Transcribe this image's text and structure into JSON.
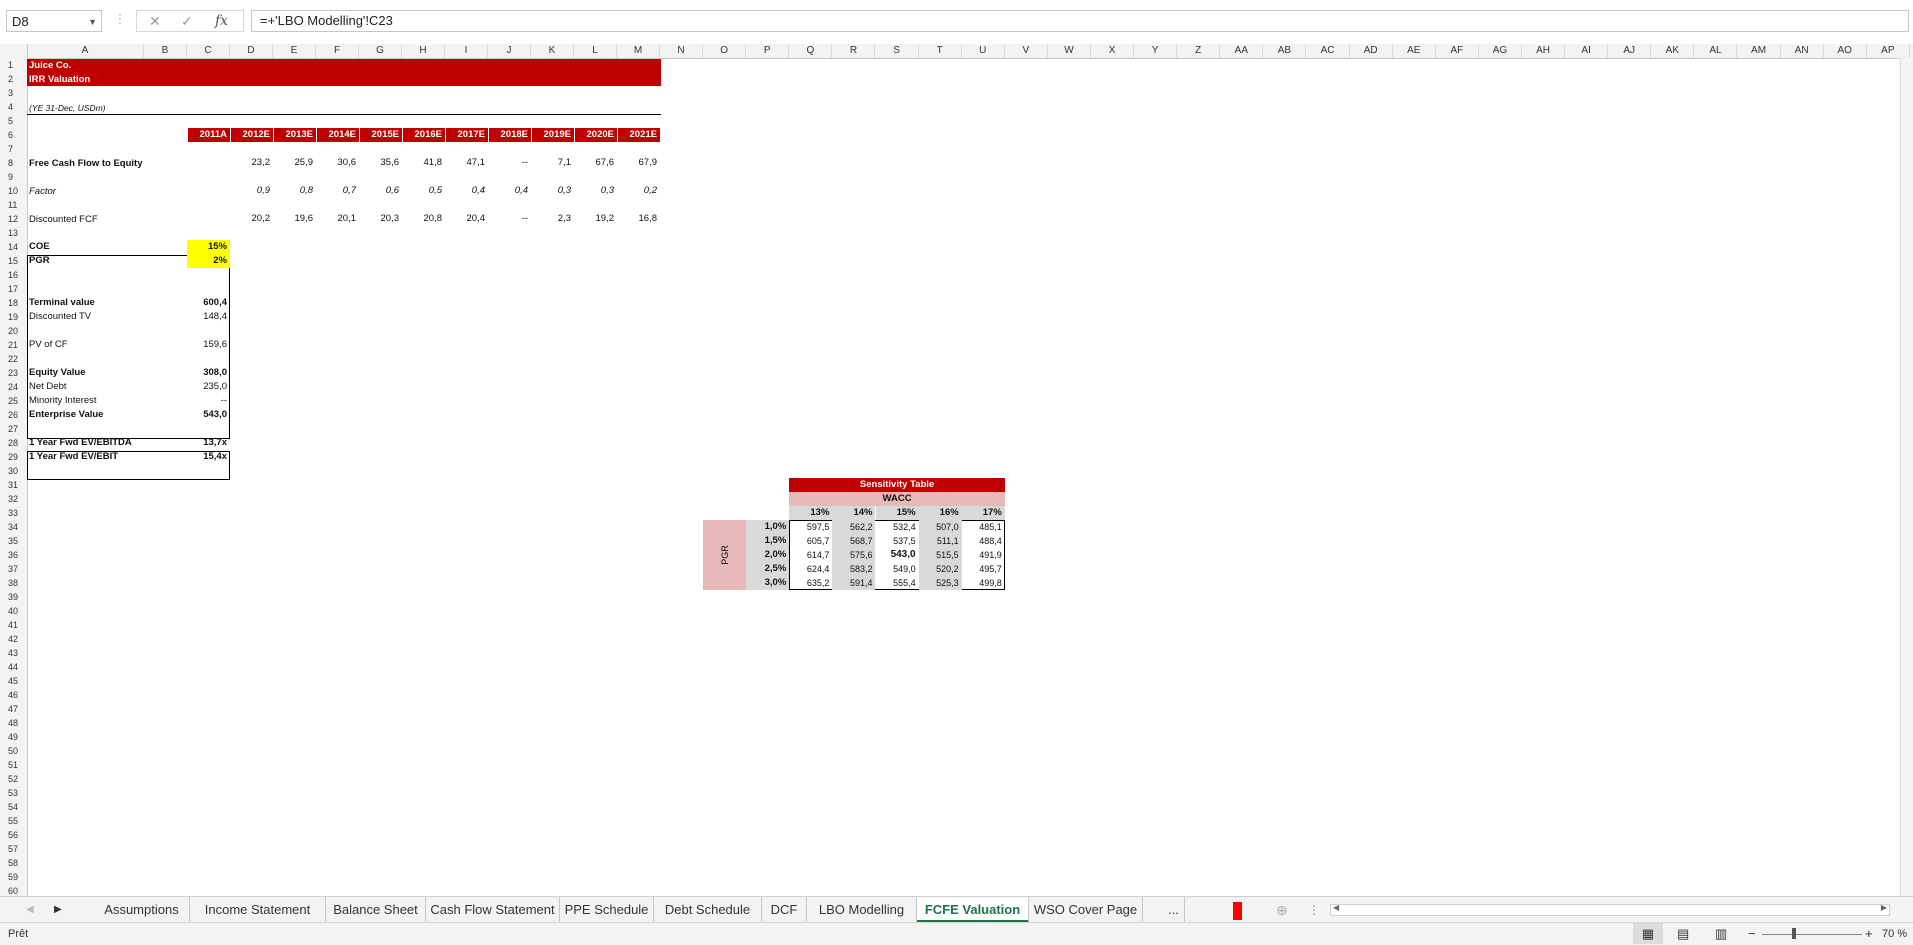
{
  "formula_bar": {
    "name_box": "D8",
    "formula": "=+'LBO Modelling'!C23",
    "cancel_glyph": "✕",
    "enter_glyph": "✓",
    "fx_glyph": "fx"
  },
  "columns": [
    "A",
    "B",
    "C",
    "D",
    "E",
    "F",
    "G",
    "H",
    "I",
    "J",
    "K",
    "L",
    "M",
    "N",
    "O",
    "P",
    "Q",
    "R",
    "S",
    "T",
    "U",
    "V",
    "W",
    "X",
    "Y",
    "Z",
    "AA",
    "AB",
    "AC",
    "AD",
    "AE",
    "AF",
    "AG",
    "AH",
    "AI",
    "AJ",
    "AK",
    "AL",
    "AM",
    "AN",
    "AO",
    "AP"
  ],
  "rows": [
    "1",
    "2",
    "3",
    "4",
    "5",
    "6",
    "7",
    "8",
    "9",
    "10",
    "11",
    "12",
    "13",
    "14",
    "15",
    "16",
    "17",
    "18",
    "19",
    "20",
    "21",
    "22",
    "23",
    "24",
    "25",
    "26",
    "27",
    "28",
    "29",
    "30",
    "31",
    "32",
    "33",
    "34",
    "35",
    "36",
    "37",
    "38",
    "39",
    "40",
    "41",
    "42",
    "43",
    "44",
    "45",
    "46",
    "47",
    "48",
    "49",
    "50",
    "51",
    "52",
    "53",
    "54",
    "55",
    "56",
    "57",
    "58",
    "59",
    "60"
  ],
  "title": {
    "company": "Juice Co.",
    "subtitle": "IRR Valuation",
    "units": "(YE 31-Dec, USDm)"
  },
  "years": [
    "2011A",
    "2012E",
    "2013E",
    "2014E",
    "2015E",
    "2016E",
    "2017E",
    "2018E",
    "2019E",
    "2020E",
    "2021E"
  ],
  "fcfe": {
    "label": "Free Cash Flow to Equity",
    "values": [
      "23,2",
      "25,9",
      "30,6",
      "35,6",
      "41,8",
      "47,1",
      "--",
      "7,1",
      "67,6",
      "67,9"
    ]
  },
  "factor": {
    "label": "Factor",
    "values": [
      "0,9",
      "0,8",
      "0,7",
      "0,6",
      "0,5",
      "0,4",
      "0,4",
      "0,3",
      "0,3",
      "0,2"
    ]
  },
  "discounted": {
    "label": "Discounted FCF",
    "values": [
      "20,2",
      "19,6",
      "20,1",
      "20,3",
      "20,8",
      "20,4",
      "--",
      "2,3",
      "19,2",
      "16,8"
    ]
  },
  "summary": [
    {
      "label": "COE",
      "value": "15%",
      "bold": true,
      "yellow": true
    },
    {
      "label": "PGR",
      "value": "2%",
      "bold": true,
      "yellow": true
    },
    {
      "label": "",
      "value": ""
    },
    {
      "label": "",
      "value": ""
    },
    {
      "label": "Terminal value",
      "value": "600,4",
      "bold": true
    },
    {
      "label": "Discounted TV",
      "value": "148,4"
    },
    {
      "label": "",
      "value": ""
    },
    {
      "label": "PV of CF",
      "value": "159,6"
    },
    {
      "label": "",
      "value": ""
    },
    {
      "label": "Equity Value",
      "value": "308,0",
      "bold": true
    },
    {
      "label": "Net Debt",
      "value": "235,0"
    },
    {
      "label": "Minority Interest",
      "value": "--"
    },
    {
      "label": "Enterprise Value",
      "value": "543,0",
      "bold": true
    }
  ],
  "multiples": [
    {
      "label": "1 Year Fwd EV/EBITDA",
      "value": "13,7x"
    },
    {
      "label": "1 Year Fwd EV/EBIT",
      "value": "15,4x"
    }
  ],
  "sensitivity": {
    "title": "Sensitivity Table",
    "col_label": "WACC",
    "row_label": "PGR",
    "cols": [
      "13%",
      "14%",
      "15%",
      "16%",
      "17%"
    ],
    "rows": [
      "1,0%",
      "1,5%",
      "2,0%",
      "2,5%",
      "3,0%"
    ],
    "values": [
      [
        "597,5",
        "562,2",
        "532,4",
        "507,0",
        "485,1"
      ],
      [
        "605,7",
        "568,7",
        "537,5",
        "511,1",
        "488,4"
      ],
      [
        "614,7",
        "575,6",
        "543,0",
        "515,5",
        "491,9"
      ],
      [
        "624,4",
        "583,2",
        "549,0",
        "520,2",
        "495,7"
      ],
      [
        "635,2",
        "591,4",
        "555,4",
        "525,3",
        "499,8"
      ]
    ]
  },
  "tabs": [
    "Assumptions",
    "Income Statement",
    "Balance Sheet",
    "Cash Flow Statement",
    "PPE Schedule",
    "Debt Schedule",
    "DCF",
    "LBO Modelling",
    "FCFE Valuation",
    "WSO Cover Page",
    "..."
  ],
  "active_tab": "FCFE Valuation",
  "status": {
    "ready": "Prêt",
    "zoom": "70 %"
  },
  "colors": {
    "accent_red": "#c00000",
    "highlight_yellow": "#ffff00",
    "excel_green": "#217346",
    "sens_pink": "#e6b8b7",
    "sens_grey": "#d9d9d9"
  }
}
